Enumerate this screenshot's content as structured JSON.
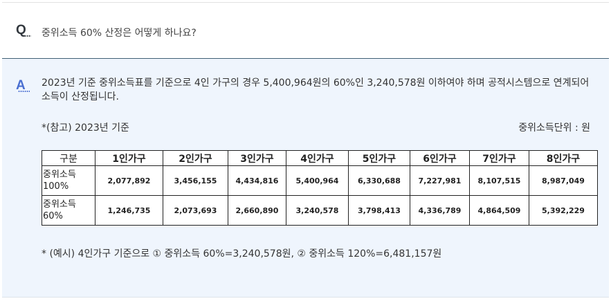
{
  "question": {
    "mark": "Q",
    "text": "중위소득 60% 산정은 어떻게 하나요?"
  },
  "answer": {
    "mark": "A",
    "text": "2023년 기준 중위소득표를 기준으로 4인 가구의 경우 5,400,964원의 60%인 3,240,578원 이하여야 하며 공적시스템으로 연계되어 소득이 산정됩니다.",
    "reference_note": "*(참고) 2023년 기준",
    "unit_note": "중위소득단위 : 원",
    "table": {
      "headers": [
        "구분",
        "1인가구",
        "2인가구",
        "3인가구",
        "4인가구",
        "5인가구",
        "6인가구",
        "7인가구",
        "8인가구"
      ],
      "rows": [
        {
          "label_line1": "중위소득",
          "label_line2": "100%",
          "values": [
            "2,077,892",
            "3,456,155",
            "4,434,816",
            "5,400,964",
            "6,330,688",
            "7,227,981",
            "8,107,515",
            "8,987,049"
          ]
        },
        {
          "label_line1": "중위소득",
          "label_line2": "60%",
          "values": [
            "1,246,735",
            "2,073,693",
            "2,660,890",
            "3,240,578",
            "3,798,413",
            "4,336,789",
            "4,864,509",
            "5,392,229"
          ]
        }
      ]
    },
    "example": "* (예시) 4인가구 기준으로 ① 중위소득 60%=3,240,578원, ② 중위소득 120%=6,481,157원"
  },
  "colors": {
    "answer_background": "#eff5fd",
    "answer_mark": "#4a6fd1",
    "question_mark": "#33393f",
    "divider": "#3f5f74"
  }
}
